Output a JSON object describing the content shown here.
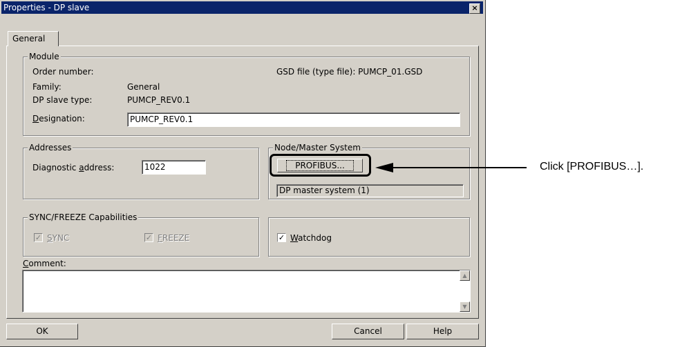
{
  "window": {
    "title": "Properties - DP slave",
    "close_glyph": "×"
  },
  "tabs": [
    {
      "label": "General",
      "active": true
    }
  ],
  "module": {
    "legend": "Module",
    "order_number_label": "Order number:",
    "family_label": "Family:",
    "family_value": "General",
    "dp_slave_type_label": "DP slave type:",
    "dp_slave_type_value": "PUMCP_REV0.1",
    "designation_label_prefix": "D",
    "designation_label_rest": "esignation:",
    "designation_value": "PUMCP_REV0.1",
    "gsd_text": "GSD file (type file): PUMCP_01.GSD"
  },
  "addresses": {
    "legend": "Addresses",
    "diag_label_pre": "Diagnostic ",
    "diag_label_u": "a",
    "diag_label_post": "ddress:",
    "diag_value": "1022"
  },
  "node_master": {
    "legend": "Node/Master System",
    "profibus_button": "PROFIBUS...",
    "master_system": "DP master system (1)"
  },
  "sync_freeze": {
    "legend": "SYNC/FREEZE Capabilities",
    "sync_u": "S",
    "sync_rest": "YNC",
    "freeze_u": "F",
    "freeze_rest": "REEZE",
    "check_glyph": "✓"
  },
  "watchdog": {
    "u": "W",
    "rest": "atchdog",
    "checked": true
  },
  "comment": {
    "label_u": "C",
    "label_rest": "omment:",
    "value": ""
  },
  "footer": {
    "ok": "OK",
    "cancel": "Cancel",
    "help": "Help"
  },
  "annotation": {
    "text": "Click [PROFIBUS…].",
    "highlight_color": "#000000"
  },
  "colors": {
    "titlebar": "#0a246a",
    "face": "#d4d0c8"
  }
}
